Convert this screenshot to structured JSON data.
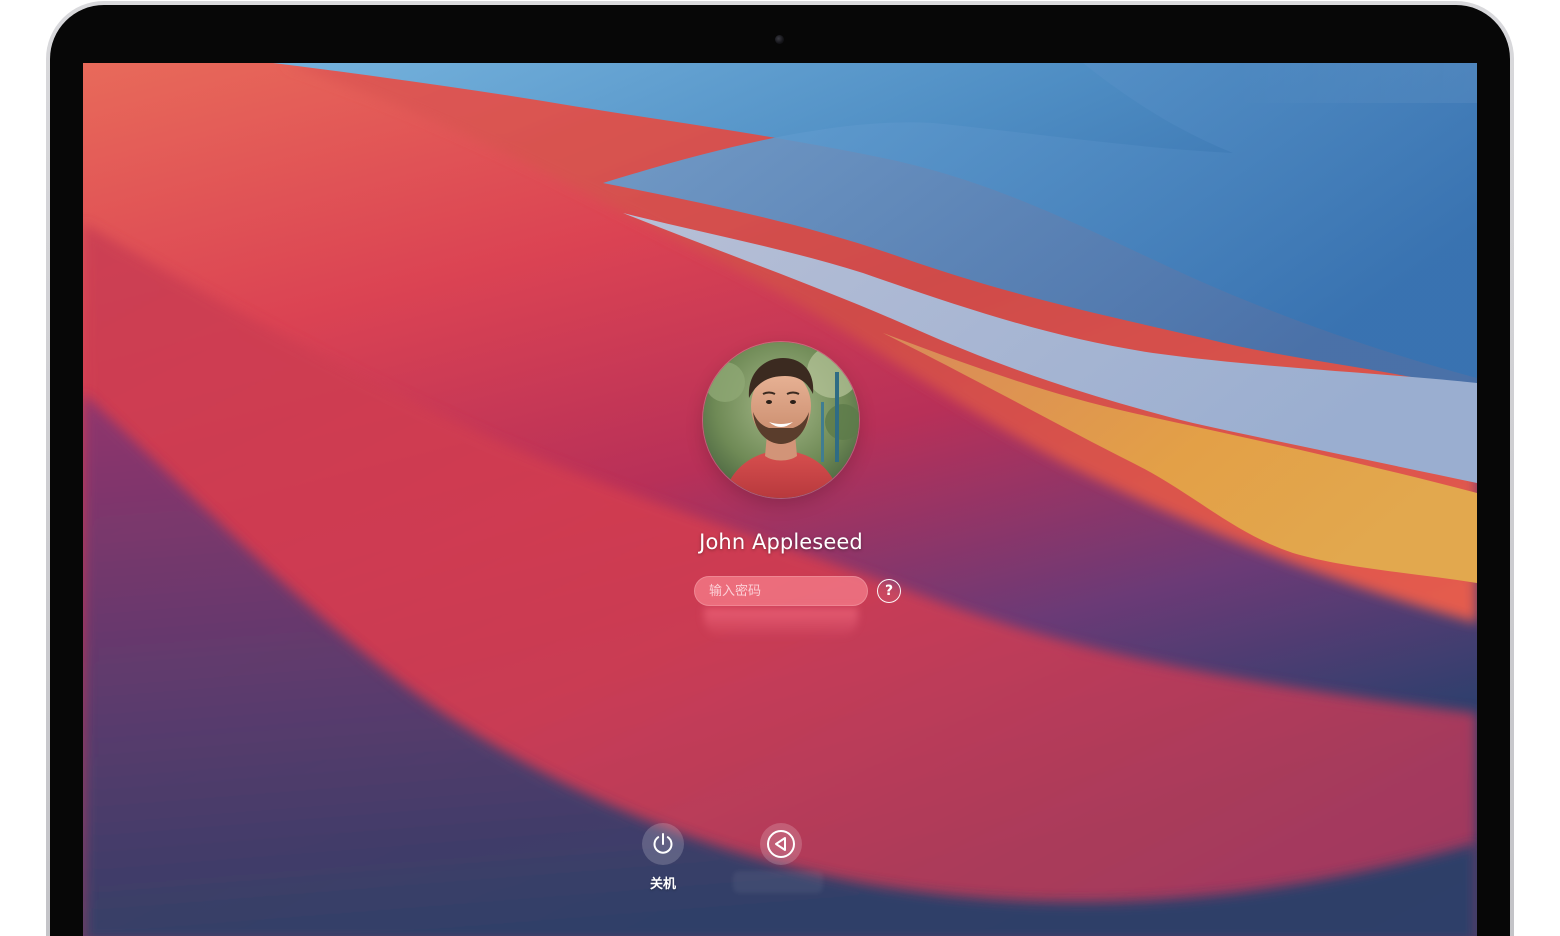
{
  "login": {
    "user_name": "John Appleseed",
    "password_placeholder": "输入密码",
    "help_label": "?"
  },
  "controls": {
    "shutdown_label": "关机"
  },
  "icons": {
    "shutdown": "power-icon",
    "back": "back-arrow-icon",
    "help": "question-icon"
  },
  "colors": {
    "wallpaper_red": "#d8404f",
    "wallpaper_blue": "#3a78b5",
    "wallpaper_orange": "#e39a4a",
    "wallpaper_purple": "#6e3a78"
  }
}
